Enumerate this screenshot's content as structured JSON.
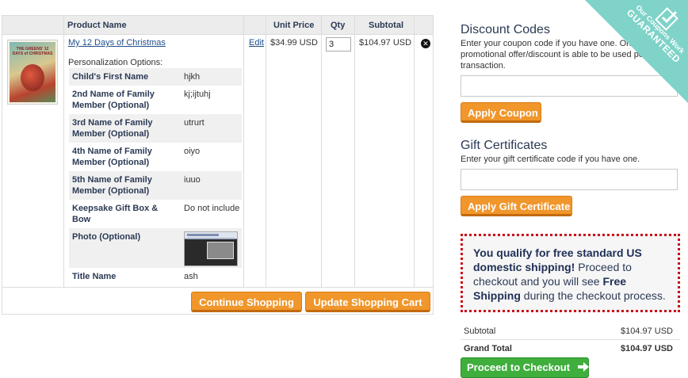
{
  "cart": {
    "headers": {
      "product": "Product Name",
      "unit_price": "Unit Price",
      "qty": "Qty",
      "subtotal": "Subtotal"
    },
    "item": {
      "title": "My 12 Days of Christmas",
      "thumbnail_text": "THE GREENS' 12 DAYS of CHRISTMAS",
      "personalization_label": "Personalization Options:",
      "options": [
        {
          "label": "Child's First Name",
          "value": "hjkh"
        },
        {
          "label": "2nd Name of Family Member (Optional)",
          "value": "kj;ijtuhj"
        },
        {
          "label": "3rd Name of Family Member (Optional)",
          "value": "utrurt"
        },
        {
          "label": "4th Name of Family Member (Optional)",
          "value": "oiyo"
        },
        {
          "label": "5th Name of Family Member (Optional)",
          "value": "iuuo"
        },
        {
          "label": "Keepsake Gift Box & Bow",
          "value": "Do not include"
        },
        {
          "label": "Photo (Optional)",
          "value": ""
        },
        {
          "label": "Title Name",
          "value": "ash"
        }
      ],
      "edit_label": "Edit",
      "unit_price": "$34.99 USD",
      "quantity": "3",
      "subtotal": "$104.97 USD",
      "remove_icon": "close-circle-icon"
    },
    "buttons": {
      "continue": "Continue Shopping",
      "update": "Update Shopping Cart"
    }
  },
  "discount": {
    "heading": "Discount Codes",
    "description": "Enter your coupon code if you have one. Only one promotional offer/discount is able to be used per transaction.",
    "input_value": "",
    "button": "Apply Coupon"
  },
  "gift": {
    "heading": "Gift Certificates",
    "description": "Enter your gift certificate code if you have one.",
    "input_value": "",
    "button": "Apply Gift Certificate"
  },
  "shipping_notice": {
    "bold1": "You qualify for free standard US domestic shipping!",
    "text1": " Proceed to checkout and you will see ",
    "bold2": "Free Shipping",
    "text2": " during the checkout process."
  },
  "summary": {
    "subtotal_label": "Subtotal",
    "subtotal_value": "$104.97 USD",
    "grand_total_label": "Grand Total",
    "grand_total_value": "$104.97 USD",
    "checkout_button": "Proceed to Checkout"
  },
  "badge": {
    "line1": "Our Coupons Work",
    "line2": "GUARANTEED"
  },
  "colors": {
    "accent_orange": "#f0962b",
    "checkout_green": "#3fae3d",
    "notice_border": "#c8101a",
    "badge_teal": "#7fd3c8",
    "heading_navy": "#2b3a55"
  }
}
